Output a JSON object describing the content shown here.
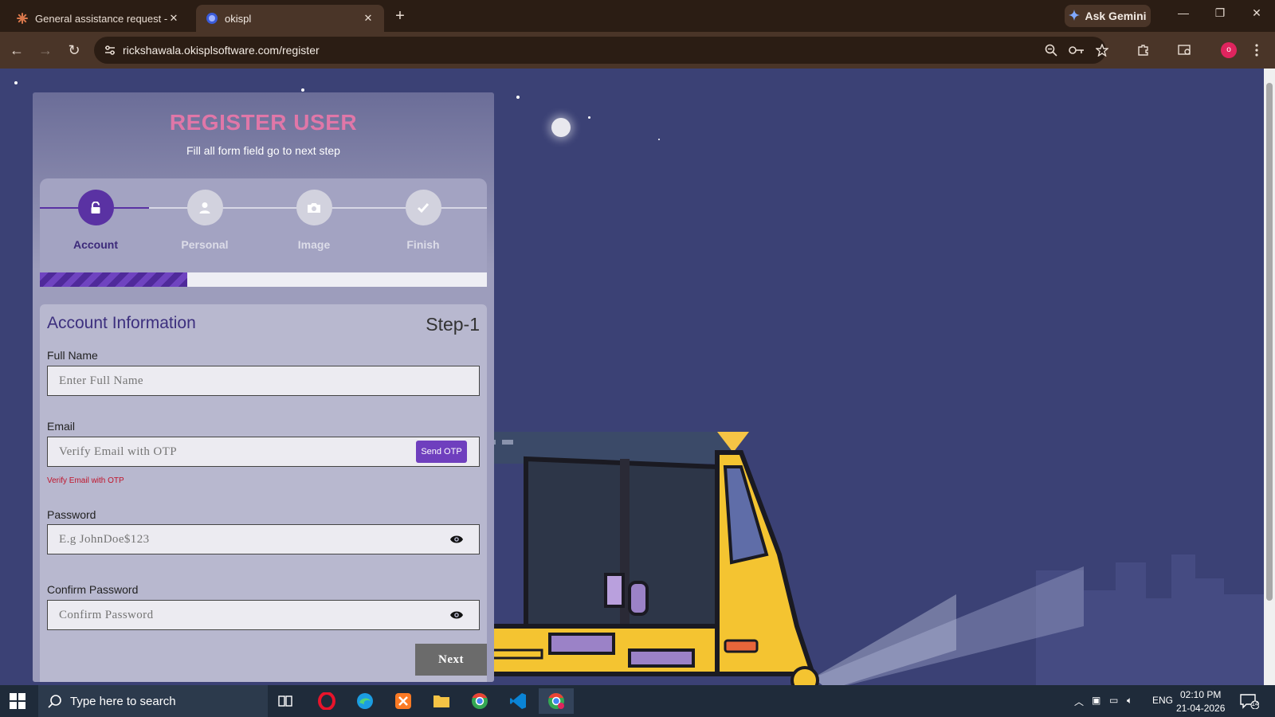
{
  "browser": {
    "tabs": [
      {
        "title": "General assistance request - Cla",
        "active": false
      },
      {
        "title": "okispl",
        "active": true
      }
    ],
    "ask_gemini": "Ask Gemini",
    "url": "rickshawala.okisplsoftware.com/register",
    "profile_initial": "o"
  },
  "register": {
    "title": "REGISTER USER",
    "subtitle": "Fill all form field go to next step",
    "steps": [
      {
        "label": "Account",
        "icon": "lock-icon",
        "active": true
      },
      {
        "label": "Personal",
        "icon": "user-icon",
        "active": false
      },
      {
        "label": "Image",
        "icon": "camera-icon",
        "active": false
      },
      {
        "label": "Finish",
        "icon": "check-icon",
        "active": false
      }
    ],
    "progress_fraction": 0.33,
    "form": {
      "heading": "Account Information",
      "step_label": "Step-1",
      "full_name": {
        "label": "Full Name",
        "placeholder": "Enter Full Name"
      },
      "email": {
        "label": "Email",
        "placeholder": "Verify Email with OTP",
        "otp_button": "Send OTP",
        "error": "Verify Email with OTP"
      },
      "password": {
        "label": "Password",
        "placeholder": "E.g JohnDoe$123"
      },
      "confirm_password": {
        "label": "Confirm Password",
        "placeholder": "Confirm Password"
      },
      "next_button": "Next"
    }
  },
  "taskbar": {
    "search_placeholder": "Type here to search",
    "language": "ENG",
    "time": "02:10 PM",
    "date": "21-04-2026",
    "notification_count": "14"
  },
  "colors": {
    "background": "#3b4175",
    "accent": "#5a32a3",
    "title_pink": "#e077a8",
    "error": "#c0142b"
  }
}
